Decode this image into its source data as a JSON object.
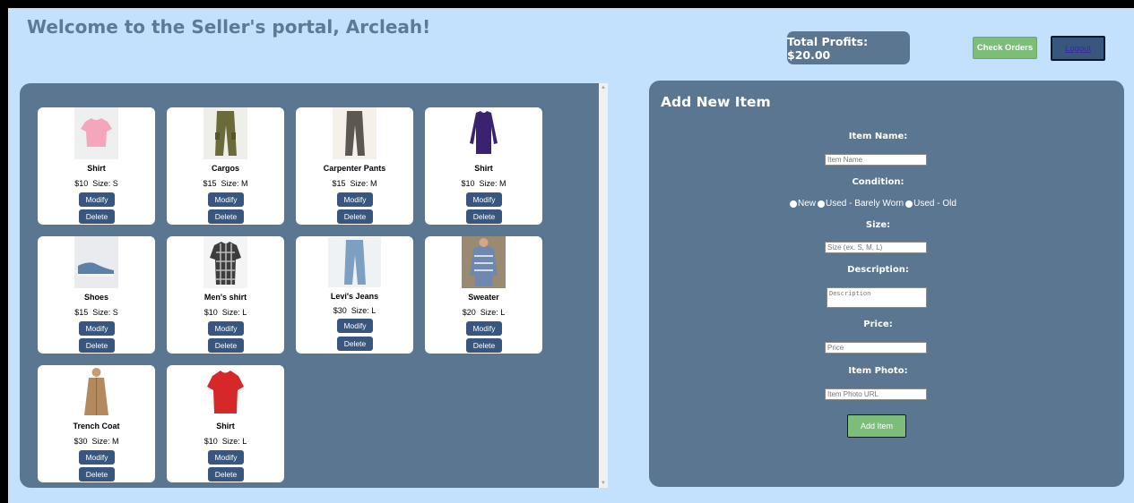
{
  "header": {
    "welcome": "Welcome to the Seller's portal, Arcleah!",
    "total_profits": "Total Profits: $20.00",
    "check_orders_label": "Check Orders",
    "logout_label": "Logout"
  },
  "items": [
    {
      "name": "Shirt",
      "price": "$10",
      "size": "Size: S",
      "modify": "Modify",
      "delete": "Delete",
      "icon": "pink-shirt-icon"
    },
    {
      "name": "Cargos",
      "price": "$15",
      "size": "Size: M",
      "modify": "Modify",
      "delete": "Delete",
      "icon": "cargo-pants-icon"
    },
    {
      "name": "Carpenter Pants",
      "price": "$15",
      "size": "Size: M",
      "modify": "Modify",
      "delete": "Delete",
      "icon": "carpenter-pants-icon"
    },
    {
      "name": "Shirt",
      "price": "$10",
      "size": "Size: M",
      "modify": "Modify",
      "delete": "Delete",
      "icon": "long-sleeve-shirt-icon"
    },
    {
      "name": "Shoes",
      "price": "$15",
      "size": "Size: S",
      "modify": "Modify",
      "delete": "Delete",
      "icon": "shoes-icon"
    },
    {
      "name": "Men's shirt",
      "price": "$10",
      "size": "Size: L",
      "modify": "Modify",
      "delete": "Delete",
      "icon": "plaid-shirt-icon"
    },
    {
      "name": "Levi's Jeans",
      "price": "$30",
      "size": "Size: L",
      "modify": "Modify",
      "delete": "Delete",
      "icon": "jeans-icon"
    },
    {
      "name": "Sweater",
      "price": "$20",
      "size": "Size: L",
      "modify": "Modify",
      "delete": "Delete",
      "icon": "sweater-icon"
    },
    {
      "name": "Trench Coat",
      "price": "$30",
      "size": "Size: M",
      "modify": "Modify",
      "delete": "Delete",
      "icon": "trench-coat-icon"
    },
    {
      "name": "Shirt",
      "price": "$10",
      "size": "Size: L",
      "modify": "Modify",
      "delete": "Delete",
      "icon": "red-shirt-icon"
    }
  ],
  "form": {
    "title": "Add New Item",
    "item_name_label": "Item Name:",
    "item_name_placeholder": "Item Name",
    "condition_label": "Condition:",
    "condition_options": [
      "New",
      "Used - Barely Worn",
      "Used - Old"
    ],
    "size_label": "Size:",
    "size_placeholder": "Size (ex. S, M, L)",
    "description_label": "Description:",
    "description_placeholder": "Description",
    "price_label": "Price:",
    "price_placeholder": "Price",
    "photo_label": "Item Photo:",
    "photo_placeholder": "Item Photo URL",
    "add_label": "Add Item"
  },
  "colors": {
    "page_bg": "#c3e1fc",
    "panel": "#5a7690",
    "button": "#39577e",
    "green": "#7cbd7a"
  }
}
